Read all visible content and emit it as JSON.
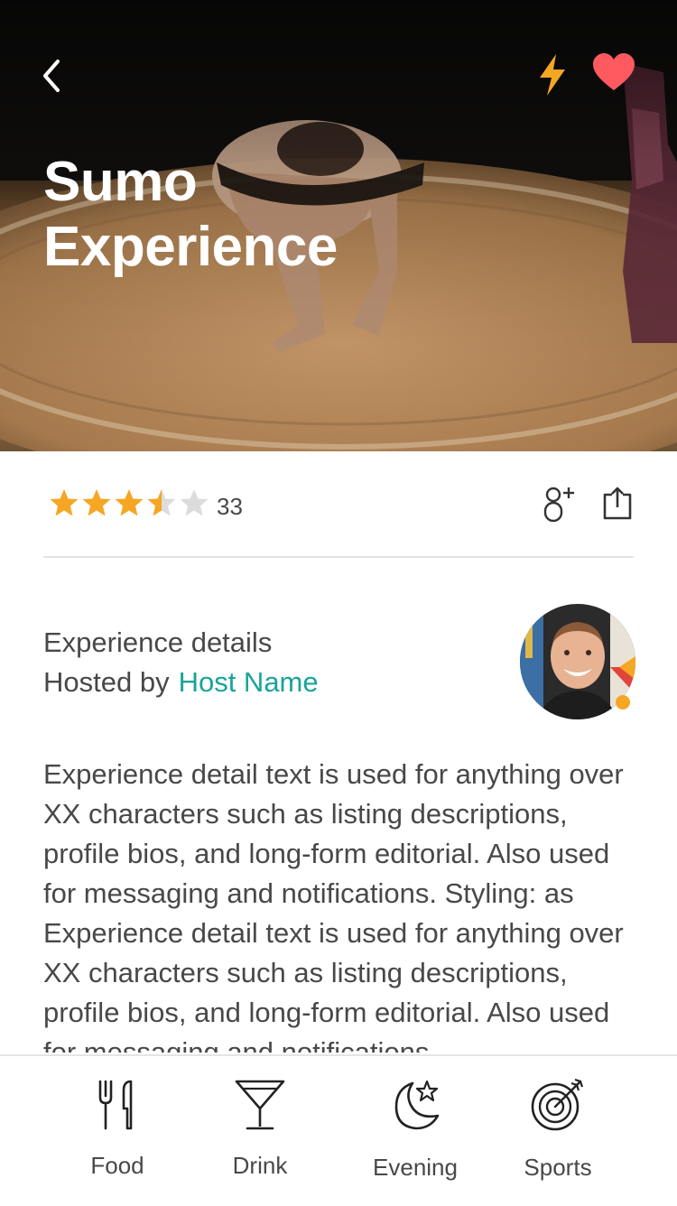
{
  "header": {
    "title_line1": "Sumo",
    "title_line2": "Experience",
    "bolt_color": "#F5A623",
    "heart_color": "#FF5A5F"
  },
  "rating": {
    "stars": 3.5,
    "max_stars": 5,
    "count": "33",
    "star_color": "#F5A623",
    "empty_star_color": "#DCDCDC"
  },
  "details": {
    "title": "Experience details",
    "hosted_by": "Hosted by",
    "host_name": "Host Name",
    "host_color": "#1AA39A",
    "text": "Experience detail text is used for anything over XX characters such as listing descriptions, profile bios, and long-form editorial. Also used for messaging and notifications. Styling: as Experience detail text is used for anything over XX characters such as listing descriptions, profile bios, and long-form editorial. Also used for messaging and notifications."
  },
  "tabs": [
    {
      "label": "Food",
      "icon": "fork-knife-icon"
    },
    {
      "label": "Drink",
      "icon": "cocktail-icon"
    },
    {
      "label": "Evening",
      "icon": "moon-star-icon"
    },
    {
      "label": "Sports",
      "icon": "target-icon"
    }
  ]
}
